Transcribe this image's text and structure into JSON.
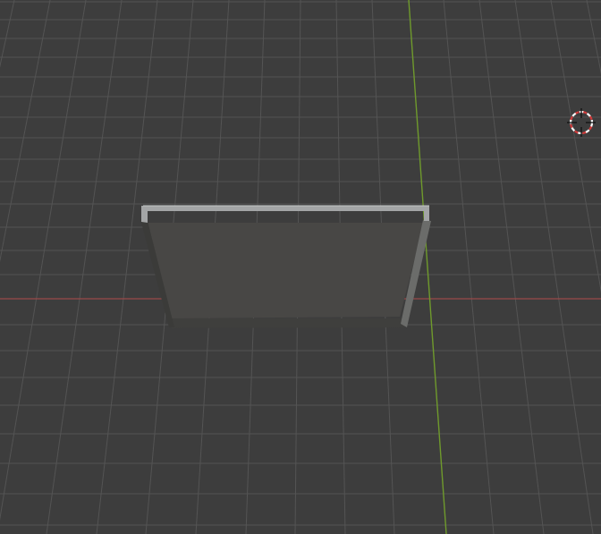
{
  "viewport": {
    "background_color": "#3d3d3d",
    "grid_line_color": "#545454",
    "x_axis_color": "#9a4a4a",
    "y_axis_color": "#6f9a2c"
  },
  "scene": {
    "selected_object": "",
    "object_face_color": "#484745",
    "object_edge_color": "#a3a5a6",
    "object_side_color": "#5e5f5d"
  },
  "cursor_3d": {
    "icon": "3d-cursor-icon",
    "ring_color_a": "#d23a3a",
    "ring_color_b": "#ffffff"
  }
}
